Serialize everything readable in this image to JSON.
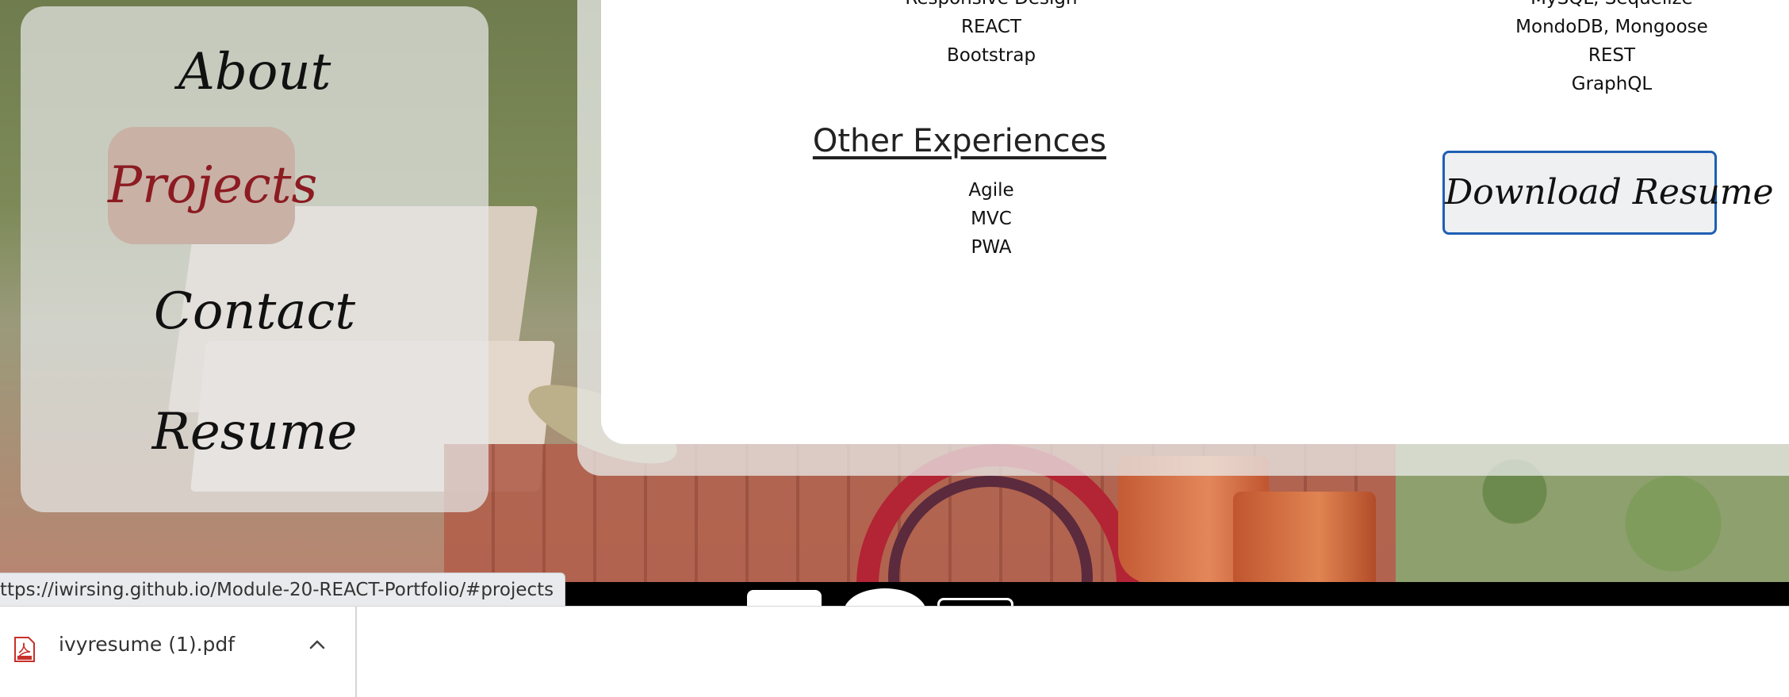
{
  "sidebar": {
    "items": [
      {
        "label": "About",
        "active": false
      },
      {
        "label": "Projects",
        "active": true
      },
      {
        "label": "Contact",
        "active": false
      },
      {
        "label": "Resume",
        "active": false
      }
    ]
  },
  "skills": {
    "left": [
      "Responsive Design",
      "REACT",
      "Bootstrap"
    ],
    "right": [
      "MySQL, Sequelize",
      "MondoDB, Mongoose",
      "REST",
      "GraphQL"
    ]
  },
  "other_experiences": {
    "title": "Other Experiences",
    "items": [
      "Agile",
      "MVC",
      "PWA"
    ]
  },
  "download_button": {
    "label": "Download Resume"
  },
  "status_bar": {
    "url": "ttps://iwirsing.github.io/Module-20-REACT-Portfolio/#projects"
  },
  "download_shelf": {
    "file_name": "ivyresume (1).pdf",
    "icons": {
      "file": "pdf-file-icon",
      "toggle": "chevron-up-icon"
    }
  },
  "colors": {
    "active_nav_bg": "#c9b1a6",
    "active_nav_text": "#8c1b22",
    "button_border": "#1e5fb4"
  }
}
